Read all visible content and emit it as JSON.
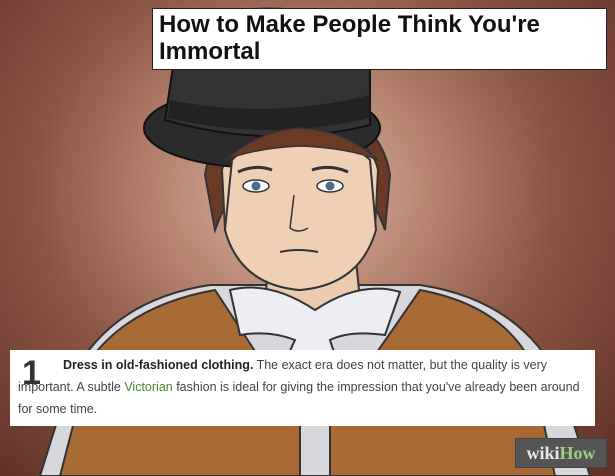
{
  "header": {
    "title_line1": "How to Make People Think You're",
    "title_line2": "Immortal"
  },
  "step": {
    "number": "1",
    "part1": "Dress in ",
    "link1": "old-fashioned",
    "part2": " clothing.",
    "part3": " The exact era does not matter, but the quality is very important. A subtle ",
    "link2": "Victorian",
    "part4": " fashion is ideal for giving the impression that you've already been around for some time."
  },
  "watermark": {
    "wiki": "wiki",
    "how": "How"
  },
  "colors": {
    "link_green": "#4a8a2a",
    "background": "#8a5443",
    "vest": "#a86a34"
  },
  "illustration": {
    "subject": "person-in-top-hat"
  }
}
